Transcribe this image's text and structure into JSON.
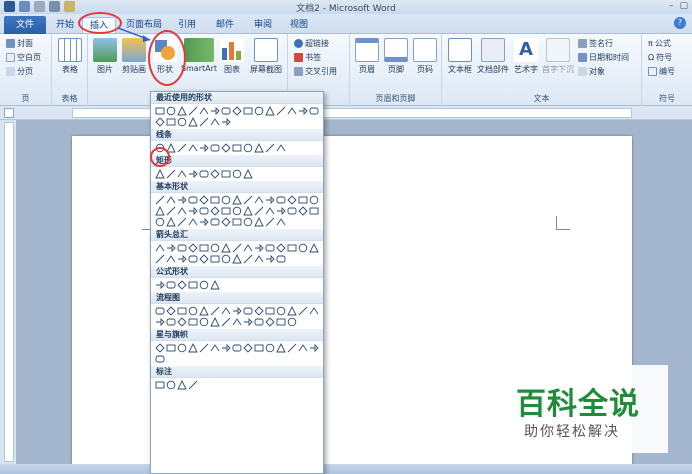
{
  "window": {
    "title": "文档2 - Microsoft Word",
    "controls": [
      "–",
      "▢",
      "✕"
    ]
  },
  "tabs": [
    {
      "label": "文件",
      "active": false
    },
    {
      "label": "开始",
      "active": false
    },
    {
      "label": "插入",
      "active": true
    },
    {
      "label": "页面布局",
      "active": false
    },
    {
      "label": "引用",
      "active": false
    },
    {
      "label": "邮件",
      "active": false
    },
    {
      "label": "审阅",
      "active": false
    },
    {
      "label": "视图",
      "active": false
    }
  ],
  "ribbon": {
    "pages": {
      "items": [
        "封面",
        "空白页",
        "分页"
      ],
      "label": "页"
    },
    "tables": {
      "button": "表格",
      "label": "表格"
    },
    "illustrations": {
      "buttons": [
        "图片",
        "剪贴画",
        "形状",
        "SmartArt",
        "图表",
        "屏幕截图"
      ]
    },
    "links": {
      "items": [
        "超链接",
        "书签",
        "交叉引用"
      ]
    },
    "header_footer": {
      "buttons": [
        "页眉",
        "页脚",
        "页码"
      ],
      "label": "页眉和页脚"
    },
    "text": {
      "buttons": [
        "文本框",
        "文档部件",
        "艺术字",
        "首字下沉"
      ],
      "items": [
        "签名行",
        "日期和时间",
        "对象"
      ],
      "label": "文本"
    },
    "symbols": {
      "items": [
        "公式",
        "符号",
        "编号"
      ],
      "label": "符号"
    }
  },
  "shapes_panel": {
    "sections": [
      {
        "title": "最近使用的形状",
        "count": 22
      },
      {
        "title": "线条",
        "count": 12
      },
      {
        "title": "矩形",
        "count": 9
      },
      {
        "title": "基本形状",
        "count": 42
      },
      {
        "title": "箭头总汇",
        "count": 27
      },
      {
        "title": "公式形状",
        "count": 6
      },
      {
        "title": "流程图",
        "count": 28
      },
      {
        "title": "星与旗帜",
        "count": 16
      },
      {
        "title": "标注",
        "count": 4
      }
    ]
  },
  "watermark": {
    "main": "百科全说",
    "sub": "助你轻松解决"
  },
  "colors": {
    "accent": "#2a5fa8",
    "highlight": "#e03a3a",
    "watermark_green": "#1f8c3a"
  }
}
